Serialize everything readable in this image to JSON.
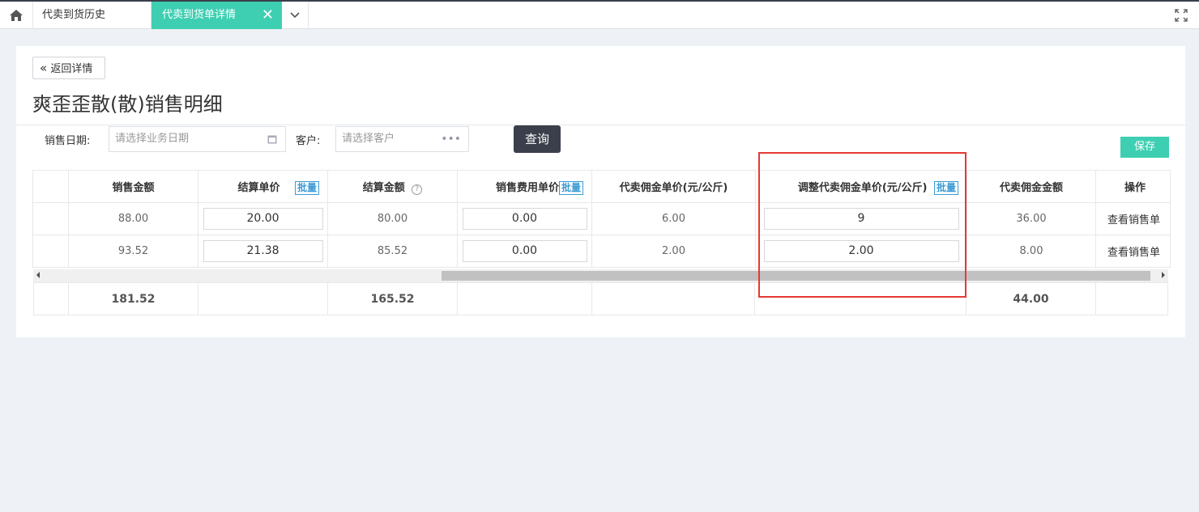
{
  "tabs": {
    "tab1": "代卖到货历史",
    "tab2": "代卖到货单详情",
    "close": "✕"
  },
  "page": {
    "back_label": "返回详情",
    "title": "爽歪歪散(散)销售明细"
  },
  "filters": {
    "date_label": "销售日期:",
    "date_placeholder": "请选择业务日期",
    "customer_label": "客户:",
    "customer_placeholder": "请选择客户",
    "query_button": "查询",
    "save_button": "保存"
  },
  "table": {
    "headers": {
      "sales_amount": "销售金额",
      "settle_price": "结算单价",
      "settle_amount": "结算金额",
      "fee_price": "销售费用单价",
      "commission_price": "代卖佣金单价(元/公斤)",
      "adjust_price": "调整代卖佣金单价(元/公斤)",
      "commission_amount": "代卖佣金金额",
      "action": "操作",
      "batch": "批量"
    },
    "rows": [
      {
        "sales_amount": "88.00",
        "settle_price": "20.00",
        "settle_amount": "80.00",
        "fee_price": "0.00",
        "commission_price": "6.00",
        "adjust_price": "9",
        "commission_amount": "36.00",
        "action": "查看销售单"
      },
      {
        "sales_amount": "93.52",
        "settle_price": "21.38",
        "settle_amount": "85.52",
        "fee_price": "0.00",
        "commission_price": "2.00",
        "adjust_price": "2.00",
        "commission_amount": "8.00",
        "action": "查看销售单"
      }
    ],
    "totals": {
      "sales_amount": "181.52",
      "settle_amount": "165.52",
      "commission_amount": "44.00"
    }
  },
  "colors": {
    "accent": "#3ecfb2",
    "dark": "#3a3f4b",
    "highlight": "#e53935",
    "batch": "#3a9bd5"
  }
}
